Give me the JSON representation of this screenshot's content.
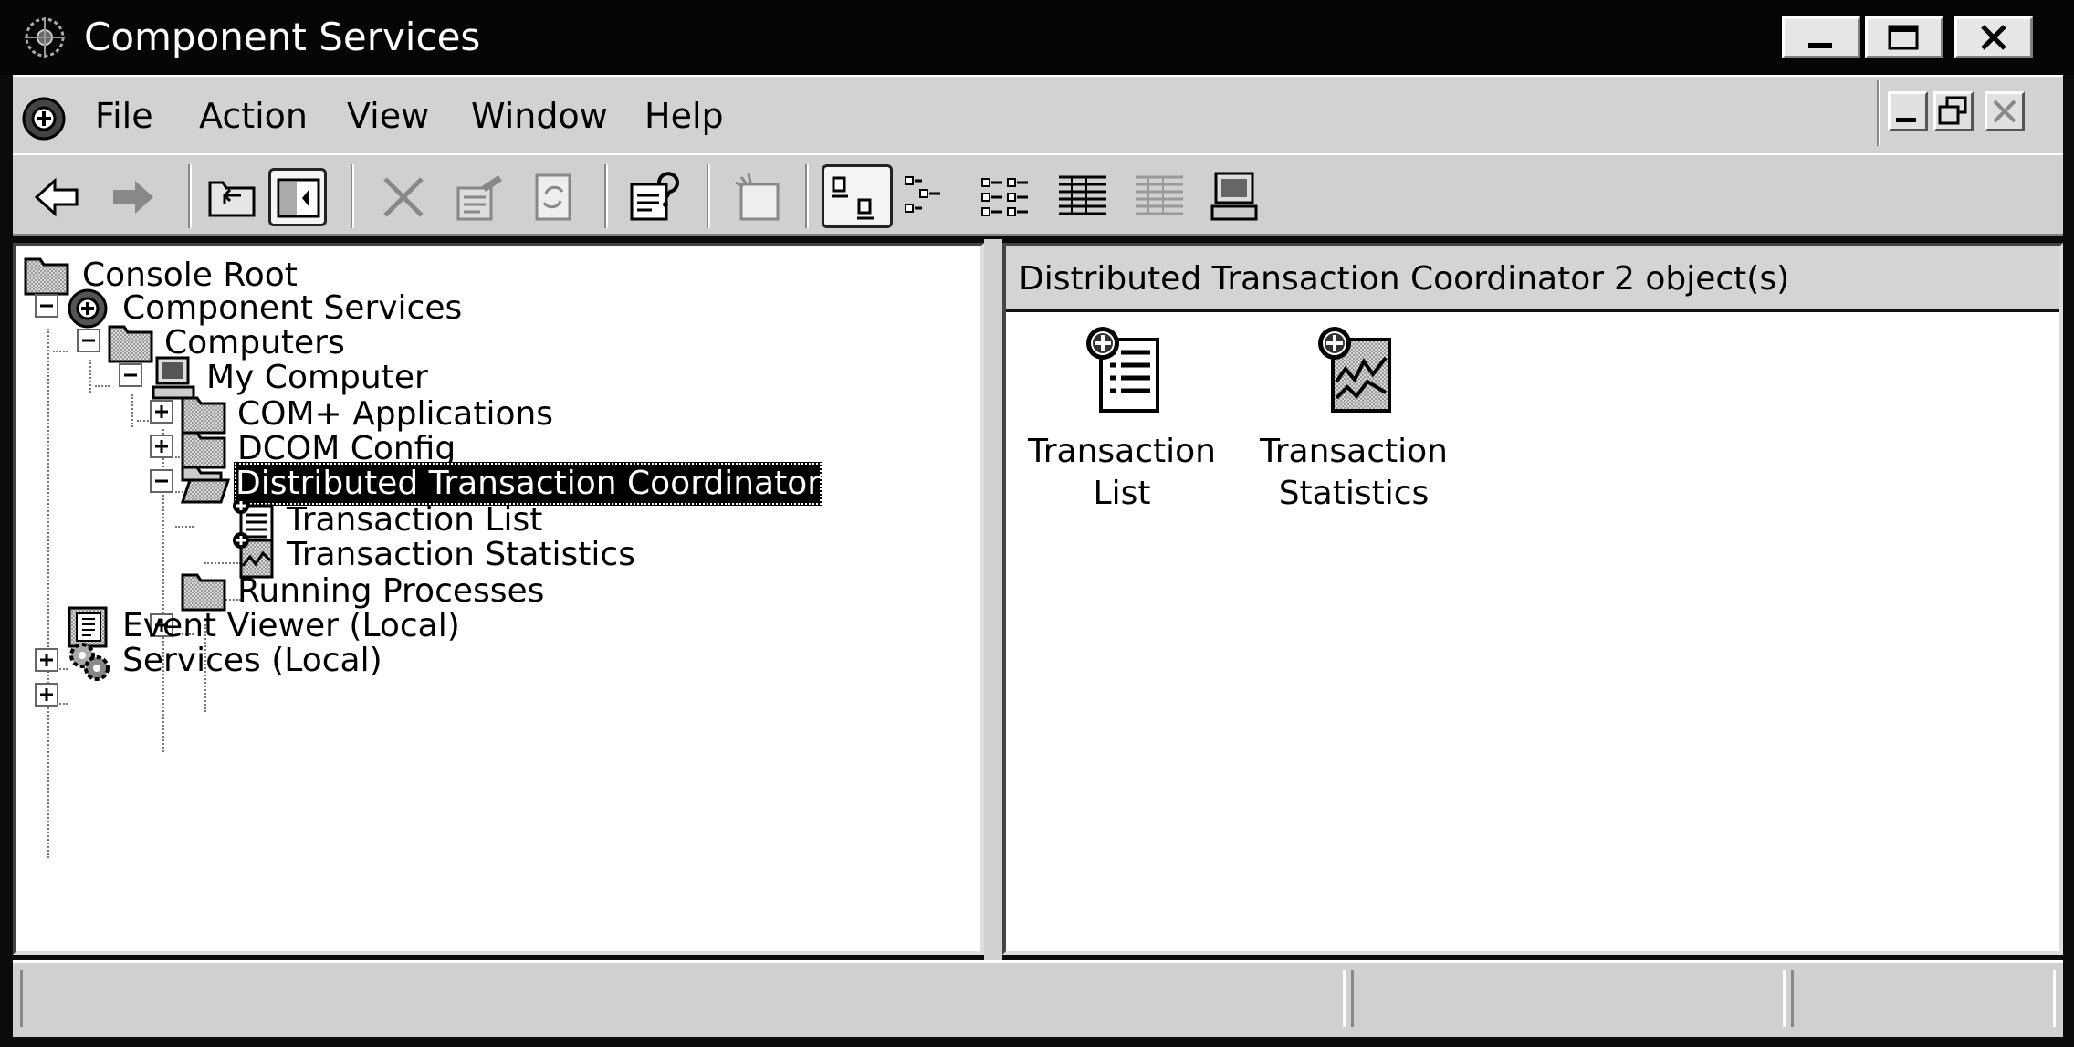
{
  "window": {
    "title": "Component Services"
  },
  "menubar": {
    "items": [
      "File",
      "Action",
      "View",
      "Window",
      "Help"
    ]
  },
  "toolbar": {
    "buttons": [
      "back-arrow-icon",
      "forward-arrow-icon",
      "up-one-level-icon",
      "show-hide-console-tree-icon",
      "delete-icon",
      "properties-icon",
      "refresh-icon",
      "help-icon",
      "new-window-icon",
      "large-icons-view-icon",
      "small-icons-view-icon",
      "list-view-icon",
      "detail-view-icon",
      "grid-view-icon",
      "computer-icon"
    ]
  },
  "tree": {
    "root": "Console Root",
    "component_services": "Component Services",
    "computers": "Computers",
    "my_computer": "My Computer",
    "com_plus": "COM+ Applications",
    "dcom": "DCOM Config",
    "dtc": "Distributed Transaction Coordinator",
    "transaction_list": "Transaction List",
    "transaction_statistics": "Transaction Statistics",
    "running_processes": "Running Processes",
    "event_viewer": "Event Viewer (Local)",
    "services": "Services (Local)"
  },
  "rightpane": {
    "title": "Distributed Transaction Coordinator",
    "count": "2 object(s)",
    "items": [
      {
        "line1": "Transaction",
        "line2": "List"
      },
      {
        "line1": "Transaction",
        "line2": "Statistics"
      }
    ]
  }
}
